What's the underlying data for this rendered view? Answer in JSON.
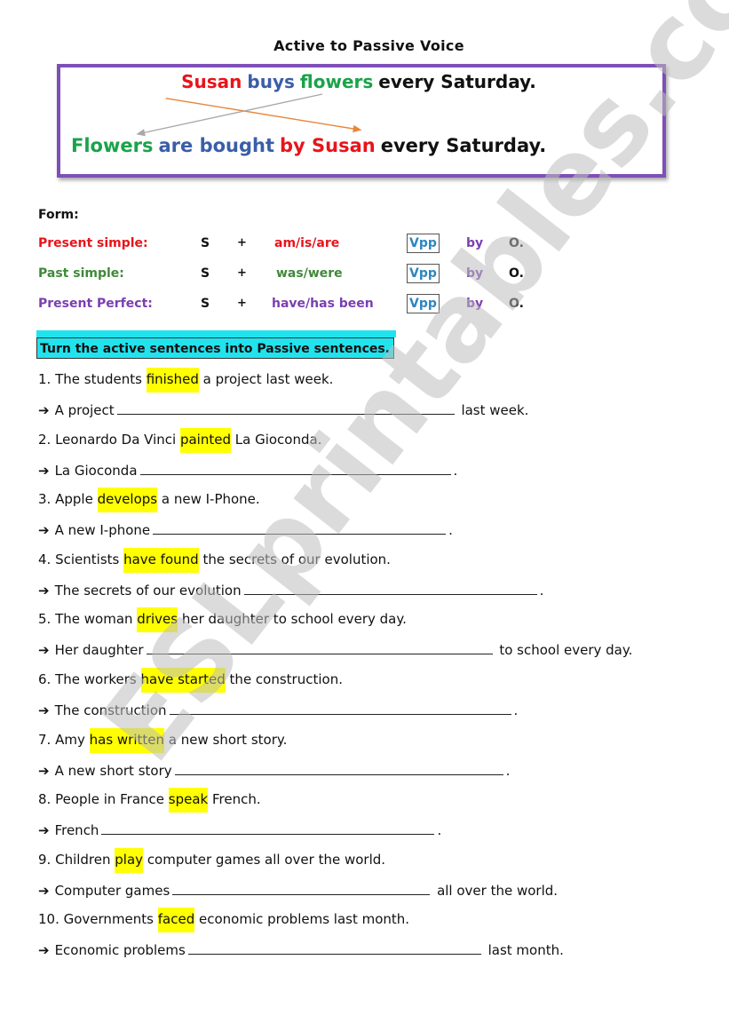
{
  "title": "Active to Passive Voice",
  "example": {
    "active": [
      {
        "text": "Susan",
        "color": "#e8141b"
      },
      {
        "text": "buys",
        "color": "#3a5ea8"
      },
      {
        "text": "flowers",
        "color": "#1aa34a"
      },
      {
        "text": "every Saturday.",
        "color": "#111111"
      }
    ],
    "passive": [
      {
        "text": "Flowers",
        "color": "#1aa34a"
      },
      {
        "text": "are bought",
        "color": "#3a5ea8"
      },
      {
        "text": "by Susan",
        "color": "#e8141b"
      },
      {
        "text": "every Saturday.",
        "color": "#111111"
      }
    ],
    "border_color": "#7f4fb8",
    "arrow_colors": {
      "subject_to_agent": "#e8853a",
      "object_to_subject": "#a8a8a8"
    }
  },
  "form": {
    "label": "Form:",
    "rows": [
      {
        "name": "Present simple:",
        "color": "#e8141b",
        "s": "S",
        "plus": "+",
        "aux": "am/is/are",
        "vpp": "Vpp",
        "by": "by",
        "o": "O."
      },
      {
        "name": "Past simple:",
        "color": "#3f8a3a",
        "s": "S",
        "plus": "+",
        "aux": "was/were",
        "vpp": "Vpp",
        "by": "by",
        "o": "O."
      },
      {
        "name": "Present Perfect:",
        "color": "#7a3fb0",
        "s": "S",
        "plus": "+",
        "aux": "have/has been",
        "vpp": "Vpp",
        "by": "by",
        "o": "O."
      }
    ]
  },
  "instruction": "Turn the active sentences into Passive sentences.",
  "exercises": [
    {
      "num": "1.",
      "before": "The students",
      "verb": "finished",
      "after": "a project last week.",
      "answer_start": "A project",
      "answer_end": "last week."
    },
    {
      "num": "2.",
      "before": "Leonardo Da Vinci",
      "verb": "painted",
      "after": "La Gioconda.",
      "answer_start": "La Gioconda",
      "answer_end": "."
    },
    {
      "num": "3.",
      "before": "Apple",
      "verb": "develops",
      "after": "a new I-Phone.",
      "answer_start": "A new I-phone",
      "answer_end": "."
    },
    {
      "num": "4.",
      "before": "Scientists",
      "verb": "have found",
      "after": "the secrets of our evolution.",
      "answer_start": "The secrets of our evolution",
      "answer_end": "."
    },
    {
      "num": "5.",
      "before": "The woman",
      "verb": "drives",
      "after": "her daughter to school every day.",
      "answer_start": "Her daughter",
      "answer_end": "to school every day."
    },
    {
      "num": "6.",
      "before": "The workers",
      "verb": "have started",
      "after": "the construction.",
      "answer_start": "The construction",
      "answer_end": "."
    },
    {
      "num": "7.",
      "before": "Amy",
      "verb": "has written",
      "after": "a new short story.",
      "answer_start": "A new short story",
      "answer_end": "."
    },
    {
      "num": "8.",
      "before": "People in France",
      "verb": "speak",
      "after": "French.",
      "answer_start": "French",
      "answer_end": "."
    },
    {
      "num": "9.",
      "before": "Children",
      "verb": "play",
      "after": "computer games all over the world.",
      "answer_start": "Computer games",
      "answer_end": "all over the world."
    },
    {
      "num": "10.",
      "before": "Governments",
      "verb": "faced",
      "after": "economic problems last month.",
      "answer_start": "Economic problems",
      "answer_end": "last month."
    }
  ],
  "arrow_glyph": "➔",
  "highlight_color": "#ffff00",
  "instruction_color": "#21e3ee",
  "watermark": "ESLprintables.com"
}
